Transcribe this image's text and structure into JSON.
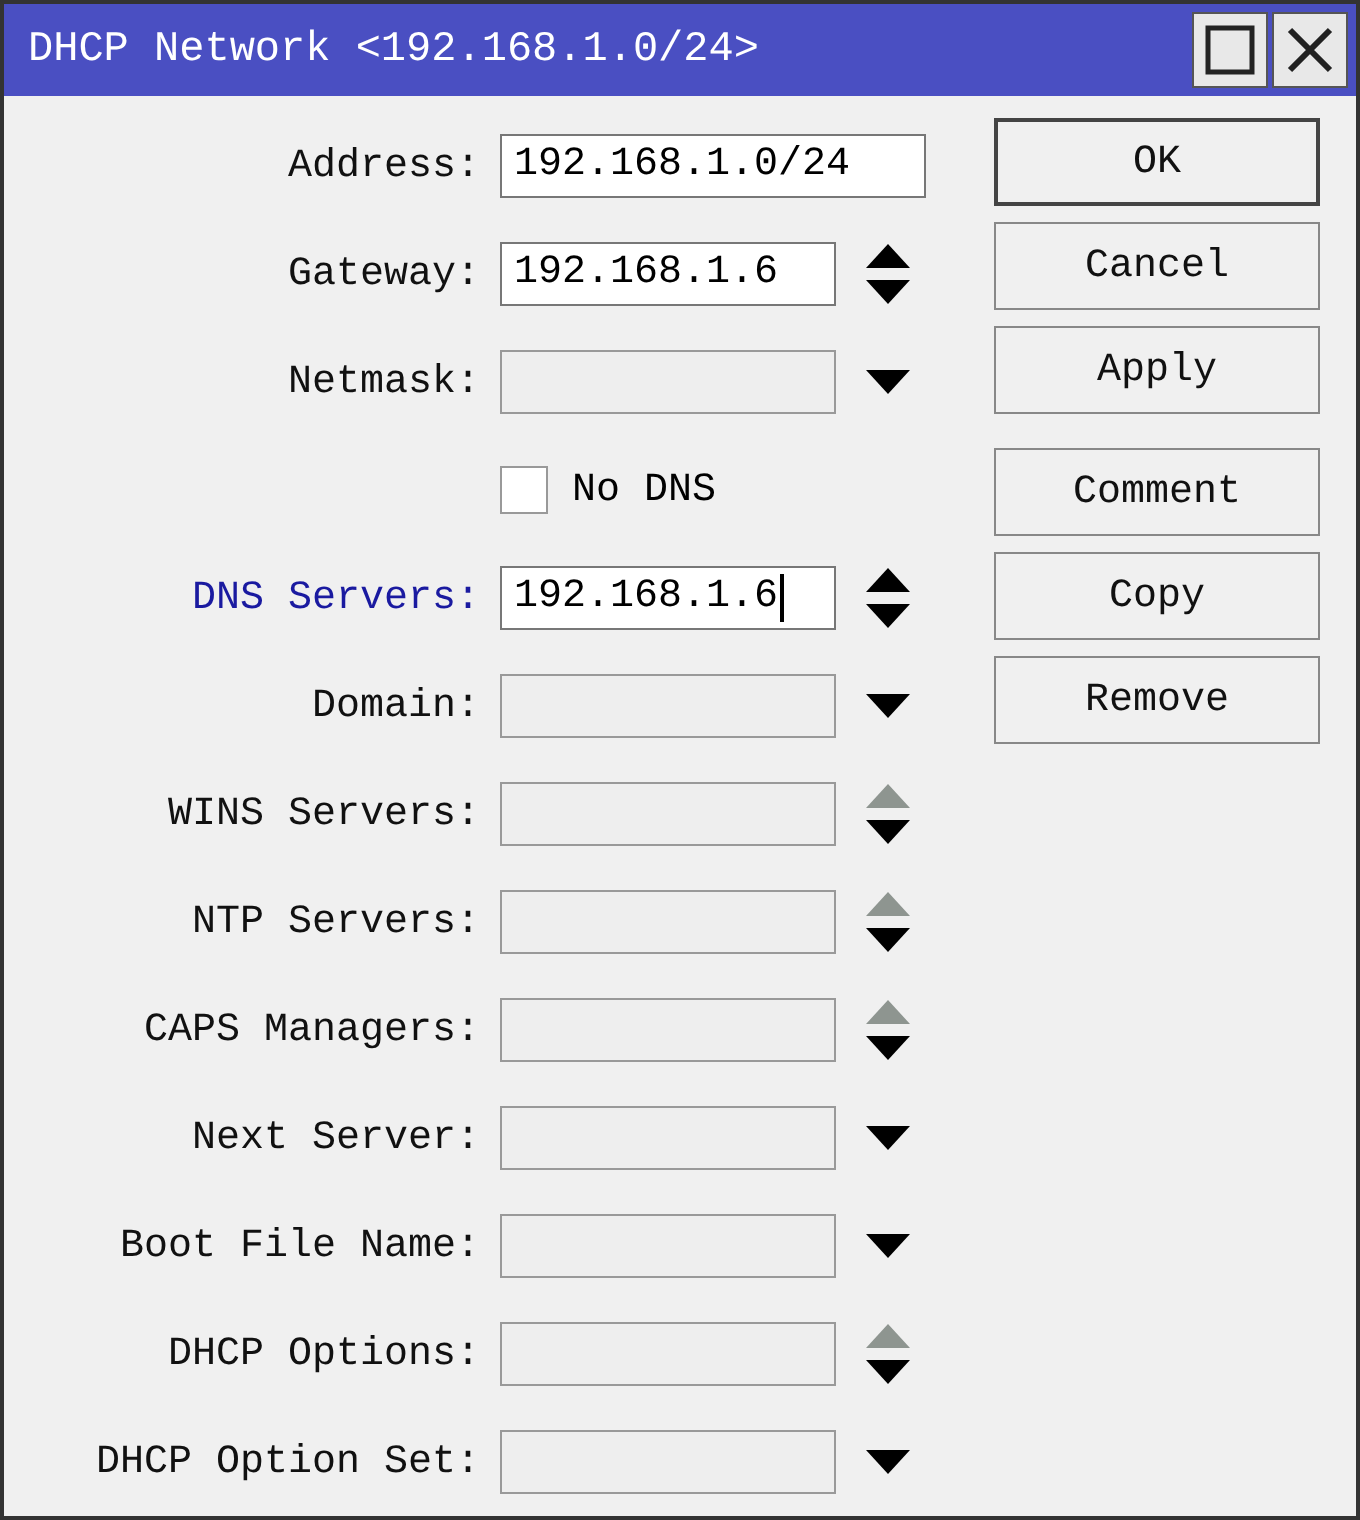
{
  "window": {
    "title": "DHCP Network <192.168.1.0/24>"
  },
  "title_buttons": [
    {
      "kind": "maximize"
    },
    {
      "kind": "close"
    }
  ],
  "rows": [
    {
      "kind": "field",
      "label": "Address:",
      "value": "192.168.1.0/24",
      "wide": true
    },
    {
      "kind": "field",
      "label": "Gateway:",
      "value": "192.168.1.6",
      "up_arrow": true,
      "up_disabled": false,
      "down_arrow": true
    },
    {
      "kind": "field",
      "label": "Netmask:",
      "down_arrow": true
    },
    {
      "kind": "checkbox",
      "label": "No DNS",
      "checked": false
    },
    {
      "kind": "field",
      "label": "DNS Servers:",
      "value": "192.168.1.6",
      "highlighted": true,
      "cursor": true,
      "up_arrow": true,
      "up_disabled": false,
      "down_arrow": true
    },
    {
      "kind": "field",
      "label": "Domain:",
      "down_arrow": true
    },
    {
      "kind": "field",
      "label": "WINS Servers:",
      "up_arrow": true,
      "up_disabled": true,
      "down_arrow": true
    },
    {
      "kind": "field",
      "label": "NTP Servers:",
      "up_arrow": true,
      "up_disabled": true,
      "down_arrow": true
    },
    {
      "kind": "field",
      "label": "CAPS Managers:",
      "up_arrow": true,
      "up_disabled": true,
      "down_arrow": true
    },
    {
      "kind": "field",
      "label": "Next Server:",
      "down_arrow": true
    },
    {
      "kind": "field",
      "label": "Boot File Name:",
      "down_arrow": true
    },
    {
      "kind": "field",
      "label": "DHCP Options:",
      "up_arrow": true,
      "up_disabled": true,
      "down_arrow": true
    },
    {
      "kind": "field",
      "label": "DHCP Option Set:",
      "down_arrow": true
    }
  ],
  "button_groups": [
    [
      {
        "label": "OK",
        "default": true
      },
      {
        "label": "Cancel",
        "default": false
      },
      {
        "label": "Apply",
        "default": false
      }
    ],
    [
      {
        "label": "Comment",
        "default": false
      },
      {
        "label": "Copy",
        "default": false
      },
      {
        "label": "Remove",
        "default": false
      }
    ]
  ]
}
